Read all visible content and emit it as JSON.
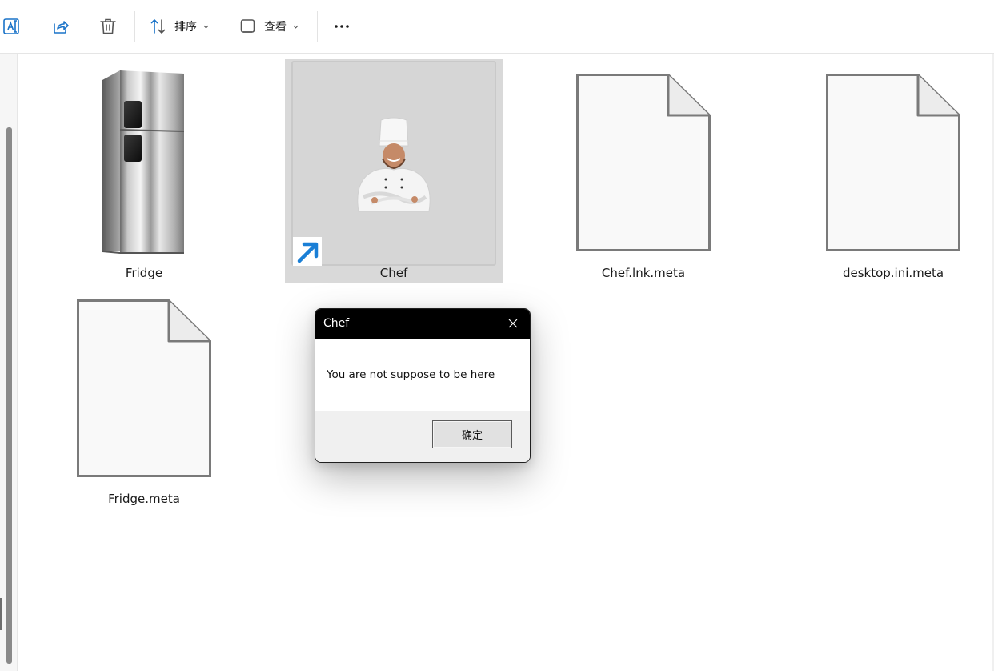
{
  "toolbar": {
    "sort_label": "排序",
    "view_label": "查看"
  },
  "files": [
    {
      "name": "Fridge",
      "kind": "fridge-image"
    },
    {
      "name": "Chef",
      "kind": "shortcut-thumbnail",
      "selected": true
    },
    {
      "name": "Chef.lnk.meta",
      "kind": "blank-file"
    },
    {
      "name": "desktop.ini.meta",
      "kind": "blank-file"
    },
    {
      "name": "Fridge.meta",
      "kind": "blank-file"
    }
  ],
  "dialog": {
    "title": "Chef",
    "message": "You are not suppose to be here",
    "ok_label": "确定"
  },
  "colors": {
    "accent_blue": "#1a73c8",
    "selection_bg": "#d9d9d9",
    "dialog_titlebar": "#000000"
  }
}
